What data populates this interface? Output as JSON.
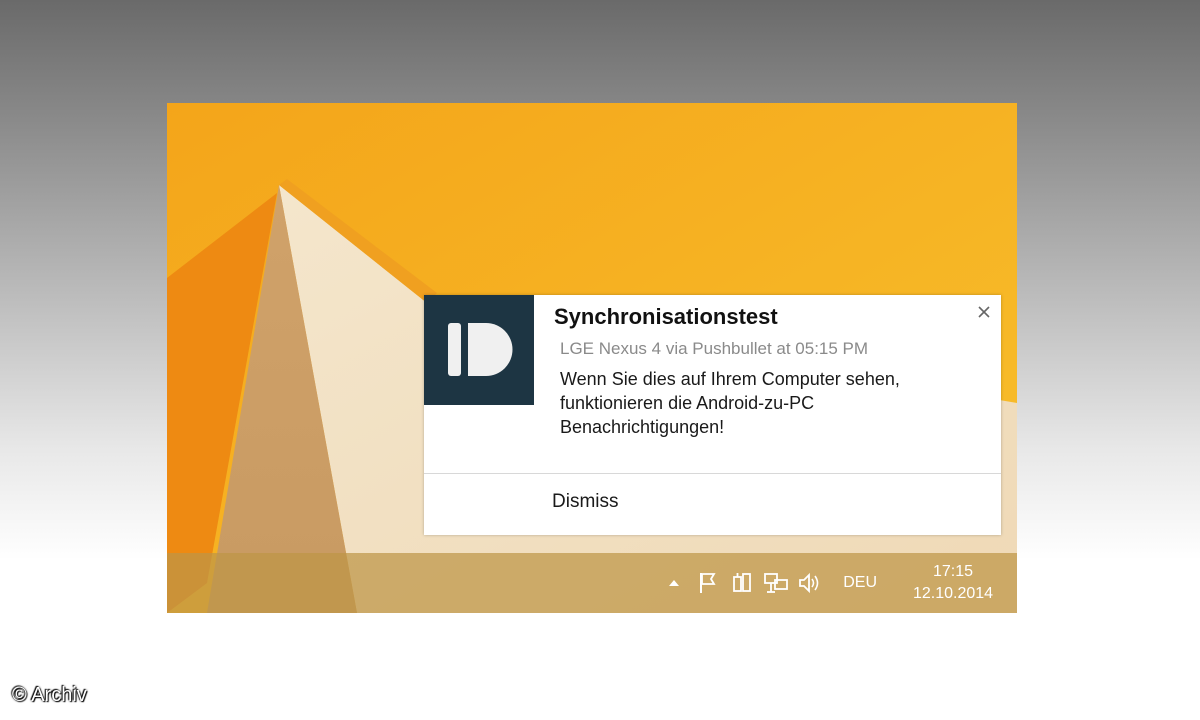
{
  "desktop": {
    "colors": {
      "wallpaper_orange": "#f6b21c",
      "wallpaper_cream": "#f2e2c4",
      "taskbar": "#be9646"
    }
  },
  "notification": {
    "app_icon": "pushbullet-logo-icon",
    "title": "Synchronisationstest",
    "source": "LGE Nexus 4 via Pushbullet at 05:15 PM",
    "body": "Wenn Sie dies auf Ihrem Computer sehen, funktionieren die Android-zu-PC Benachrichtigungen!",
    "dismiss_label": "Dismiss",
    "close_icon": "close-icon",
    "colors": {
      "logo_bg": "#1d3543",
      "logo_fg": "#f0f0f0"
    }
  },
  "taskbar": {
    "tray_icons": [
      "show-hidden-icons-arrow-icon",
      "action-center-flag-icon",
      "power-icon",
      "network-icon",
      "volume-icon"
    ],
    "language": "DEU",
    "time": "17:15",
    "date": "12.10.2014"
  },
  "watermark": {
    "text": "© Archiv"
  }
}
